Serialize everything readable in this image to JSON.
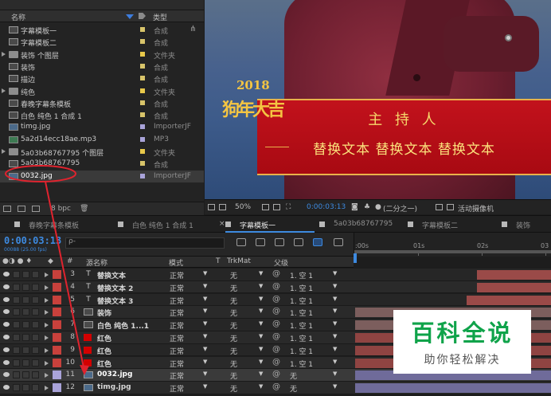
{
  "project": {
    "col_name": "名称",
    "col_type": "类型",
    "items": [
      {
        "name": "字幕模板一",
        "type": "合成",
        "kind": "comp",
        "label": "#d8c46a",
        "expandable": false
      },
      {
        "name": "字幕模板二",
        "type": "合成",
        "kind": "comp",
        "label": "#d8c46a",
        "expandable": false
      },
      {
        "name": "装饰 个图层",
        "type": "文件夹",
        "kind": "folder",
        "label": "#e8c84a",
        "expandable": true
      },
      {
        "name": "装饰",
        "type": "合成",
        "kind": "comp",
        "label": "#d8c46a",
        "expandable": false
      },
      {
        "name": "描边",
        "type": "合成",
        "kind": "comp",
        "label": "#d8c46a",
        "expandable": false
      },
      {
        "name": "纯色",
        "type": "文件夹",
        "kind": "folder",
        "label": "#e8c84a",
        "expandable": true
      },
      {
        "name": "春晚字幕条模板",
        "type": "合成",
        "kind": "comp",
        "label": "#d8c46a",
        "expandable": false
      },
      {
        "name": "白色 纯色 1 合成 1",
        "type": "合成",
        "kind": "comp",
        "label": "#d8c46a",
        "expandable": false
      },
      {
        "name": "timg.jpg",
        "type": "ImporterJF",
        "kind": "img",
        "label": "#a9a3d9",
        "expandable": false
      },
      {
        "name": "5a2d14ecc18ae.mp3",
        "type": "MP3",
        "kind": "audio",
        "label": "#a9a3d9",
        "expandable": false
      },
      {
        "name": "5a03b68767795 个图层",
        "type": "文件夹",
        "kind": "folder",
        "label": "#e8c84a",
        "expandable": true
      },
      {
        "name": "5a03b68767795",
        "type": "合成",
        "kind": "comp",
        "label": "#d8c46a",
        "expandable": false
      },
      {
        "name": "0032.jpg",
        "type": "ImporterJF",
        "kind": "img",
        "label": "#a9a3d9",
        "expandable": false,
        "selected": true
      }
    ],
    "footer_bpc": "8 bpc"
  },
  "viewer": {
    "banner_title": "主 持 人",
    "banner_sub": "替换文本 替换文本  替换文本",
    "logo_year": "2018",
    "logo_text": "狗年大吉",
    "toolbar": {
      "zoom": "50%",
      "timecode": "0:00:03:13",
      "resolution": "(二分之一)",
      "camera": "活动摄像机"
    }
  },
  "timeline": {
    "tabs": [
      {
        "label": "春晚字幕条模板",
        "swatch": "#b8b8b8",
        "active": false
      },
      {
        "label": "白色 纯色 1 合成 1",
        "swatch": "#b8b8b8",
        "active": false
      },
      {
        "label": "字幕模板一",
        "swatch": "#b8b8b8",
        "active": true
      },
      {
        "label": "5a03b68767795",
        "swatch": "#b8b8b8",
        "active": false
      },
      {
        "label": "字幕模板二",
        "swatch": "#b8b8b8",
        "active": false
      },
      {
        "label": "装饰",
        "swatch": "#b8b8b8",
        "active": false
      }
    ],
    "timecode": "0:00:03:13",
    "fps": "00088 (25.00 fps)",
    "search_placeholder": "ρ-",
    "ruler": [
      ":00s",
      "01s",
      "02s",
      "03"
    ],
    "columns": {
      "name": "源名称",
      "mode": "模式",
      "t": "T",
      "trkmat": "TrkMat",
      "parent": "父级",
      "num": "#"
    },
    "layers": [
      {
        "num": "3",
        "kind": "text",
        "name": "替换文本",
        "mode": "正常",
        "trkmat": "无",
        "parent": "1. 空 1",
        "label": "#c8413c",
        "bar_start": 0.62,
        "bar_color": "#9a4a48"
      },
      {
        "num": "4",
        "kind": "text",
        "name": "替换文本 2",
        "mode": "正常",
        "trkmat": "无",
        "parent": "1. 空 1",
        "label": "#c8413c",
        "bar_start": 0.62,
        "bar_color": "#9a4a48"
      },
      {
        "num": "5",
        "kind": "text",
        "name": "替换文本 3",
        "mode": "正常",
        "trkmat": "无",
        "parent": "1. 空 1",
        "label": "#c8413c",
        "bar_start": 0.57,
        "bar_color": "#9a4a48"
      },
      {
        "num": "6",
        "kind": "comp",
        "name": "装饰",
        "mode": "正常",
        "trkmat": "无",
        "parent": "1. 空 1",
        "label": "#c8413c",
        "bar_start": 0.0,
        "bar_color": "#7c5e5d"
      },
      {
        "num": "7",
        "kind": "comp",
        "name": "白色 纯色 1...1",
        "mode": "正常",
        "trkmat": "无",
        "parent": "1. 空 1",
        "label": "#c8413c",
        "bar_start": 0.0,
        "bar_color": "#7c5e5d"
      },
      {
        "num": "8",
        "kind": "solid",
        "name": "红色",
        "mode": "正常",
        "trkmat": "无",
        "parent": "1. 空 1",
        "label": "#c8413c",
        "bar_start": 0.0,
        "bar_color": "#8f4442"
      },
      {
        "num": "9",
        "kind": "solid",
        "name": "红色",
        "mode": "正常",
        "trkmat": "无",
        "parent": "1. 空 1",
        "label": "#c8413c",
        "bar_start": 0.0,
        "bar_color": "#8f4442"
      },
      {
        "num": "10",
        "kind": "solid",
        "name": "红色",
        "mode": "正常",
        "trkmat": "无",
        "parent": "1. 空 1",
        "label": "#c8413c",
        "bar_start": 0.0,
        "bar_color": "#8f4442"
      },
      {
        "num": "11",
        "kind": "img",
        "name": "0032.jpg",
        "mode": "正常",
        "trkmat": "无",
        "parent": "无",
        "label": "#a9a3d9",
        "bar_start": 0.0,
        "bar_color": "#6f6b9a",
        "selected": true
      },
      {
        "num": "12",
        "kind": "img",
        "name": "timg.jpg",
        "mode": "正常",
        "trkmat": "无",
        "parent": "无",
        "label": "#a9a3d9",
        "bar_start": 0.0,
        "bar_color": "#6f6b9a"
      }
    ]
  },
  "watermark": {
    "title": "百科全说",
    "subtitle": "助你轻松解决"
  },
  "colors": {
    "accent": "#3d8ae0",
    "annotation": "#e0232e",
    "watermark_green": "#0fa34a"
  }
}
